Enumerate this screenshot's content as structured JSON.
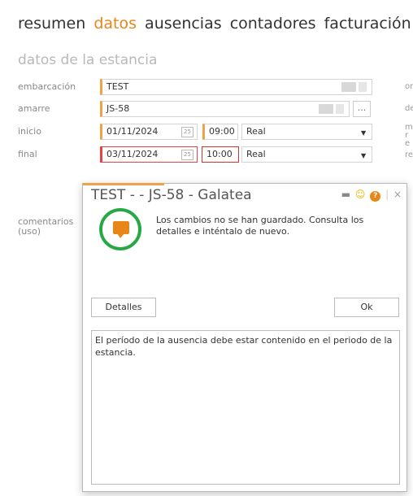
{
  "tabs": {
    "resumen": "resumen",
    "datos": "datos",
    "ausencias": "ausencias",
    "contadores": "contadores",
    "facturacion": "facturación"
  },
  "section": {
    "title": "datos de la estancia"
  },
  "form": {
    "embarcacion": {
      "label": "embarcación",
      "value": "TEST"
    },
    "amarre": {
      "label": "amarre",
      "value": "JS-58",
      "button": "..."
    },
    "inicio": {
      "label": "inicio",
      "date": "01/11/2024",
      "time": "09:00",
      "type": "Real",
      "cal_icon": "25"
    },
    "final": {
      "label": "final",
      "date": "03/11/2024",
      "time": "10:00",
      "type": "Real",
      "cal_icon": "25"
    },
    "comentarios": {
      "label": "comentarios\n(uso)"
    }
  },
  "right_labels": [
    "or",
    "de",
    "m re",
    "re"
  ],
  "dialog": {
    "title": "TEST -  - JS-58 - Galatea",
    "message": "Los cambios no se han guardado. Consulta los detalles e inténtalo de nuevo.",
    "details_button": "Detalles",
    "ok_button": "Ok",
    "details_text": "El período de la ausencia debe estar contenido en el periodo de la estancia.",
    "colors": {
      "accent": "#f0a24a",
      "success": "#28a745",
      "error": "#d9342b"
    }
  }
}
